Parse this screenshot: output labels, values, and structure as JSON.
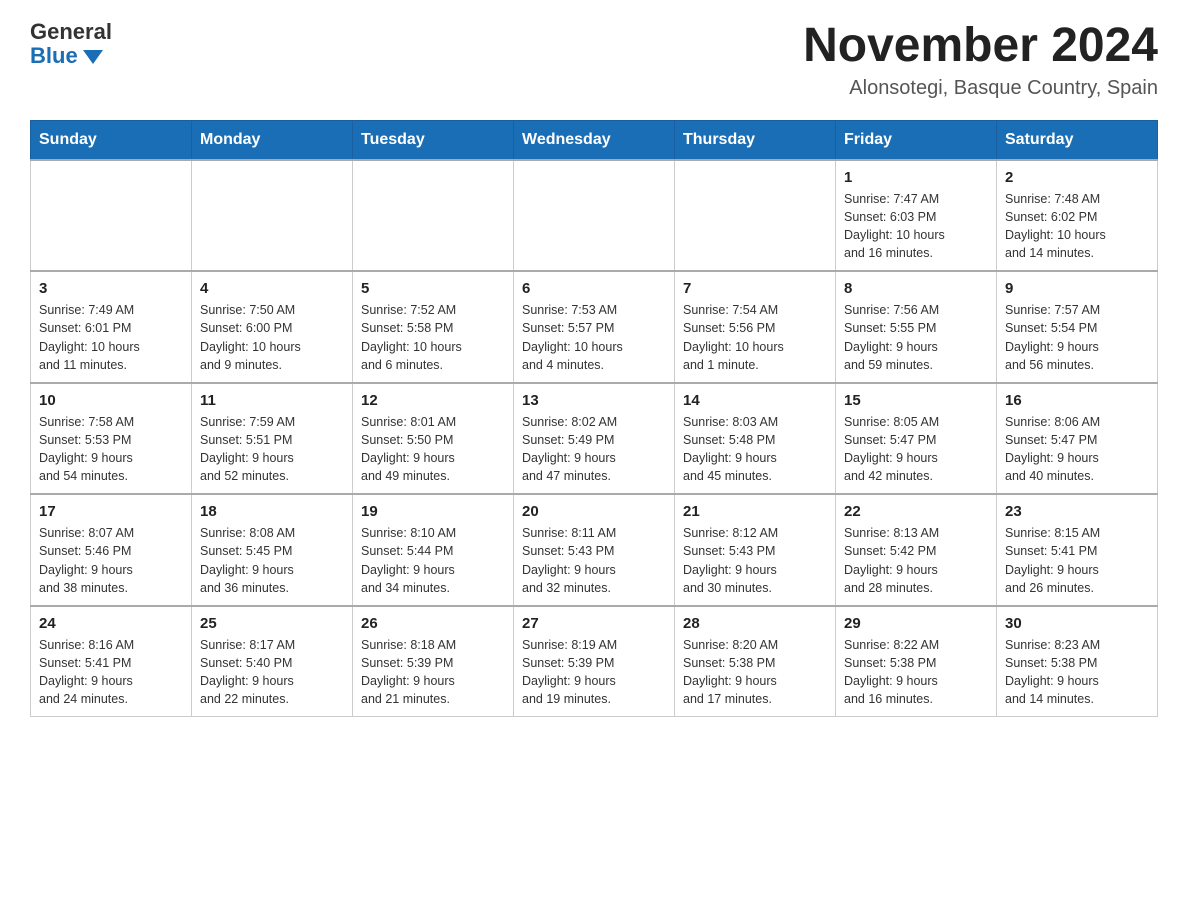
{
  "header": {
    "logo_general": "General",
    "logo_blue": "Blue",
    "title": "November 2024",
    "subtitle": "Alonsotegi, Basque Country, Spain"
  },
  "weekdays": [
    "Sunday",
    "Monday",
    "Tuesday",
    "Wednesday",
    "Thursday",
    "Friday",
    "Saturday"
  ],
  "weeks": [
    [
      {
        "day": "",
        "info": ""
      },
      {
        "day": "",
        "info": ""
      },
      {
        "day": "",
        "info": ""
      },
      {
        "day": "",
        "info": ""
      },
      {
        "day": "",
        "info": ""
      },
      {
        "day": "1",
        "info": "Sunrise: 7:47 AM\nSunset: 6:03 PM\nDaylight: 10 hours\nand 16 minutes."
      },
      {
        "day": "2",
        "info": "Sunrise: 7:48 AM\nSunset: 6:02 PM\nDaylight: 10 hours\nand 14 minutes."
      }
    ],
    [
      {
        "day": "3",
        "info": "Sunrise: 7:49 AM\nSunset: 6:01 PM\nDaylight: 10 hours\nand 11 minutes."
      },
      {
        "day": "4",
        "info": "Sunrise: 7:50 AM\nSunset: 6:00 PM\nDaylight: 10 hours\nand 9 minutes."
      },
      {
        "day": "5",
        "info": "Sunrise: 7:52 AM\nSunset: 5:58 PM\nDaylight: 10 hours\nand 6 minutes."
      },
      {
        "day": "6",
        "info": "Sunrise: 7:53 AM\nSunset: 5:57 PM\nDaylight: 10 hours\nand 4 minutes."
      },
      {
        "day": "7",
        "info": "Sunrise: 7:54 AM\nSunset: 5:56 PM\nDaylight: 10 hours\nand 1 minute."
      },
      {
        "day": "8",
        "info": "Sunrise: 7:56 AM\nSunset: 5:55 PM\nDaylight: 9 hours\nand 59 minutes."
      },
      {
        "day": "9",
        "info": "Sunrise: 7:57 AM\nSunset: 5:54 PM\nDaylight: 9 hours\nand 56 minutes."
      }
    ],
    [
      {
        "day": "10",
        "info": "Sunrise: 7:58 AM\nSunset: 5:53 PM\nDaylight: 9 hours\nand 54 minutes."
      },
      {
        "day": "11",
        "info": "Sunrise: 7:59 AM\nSunset: 5:51 PM\nDaylight: 9 hours\nand 52 minutes."
      },
      {
        "day": "12",
        "info": "Sunrise: 8:01 AM\nSunset: 5:50 PM\nDaylight: 9 hours\nand 49 minutes."
      },
      {
        "day": "13",
        "info": "Sunrise: 8:02 AM\nSunset: 5:49 PM\nDaylight: 9 hours\nand 47 minutes."
      },
      {
        "day": "14",
        "info": "Sunrise: 8:03 AM\nSunset: 5:48 PM\nDaylight: 9 hours\nand 45 minutes."
      },
      {
        "day": "15",
        "info": "Sunrise: 8:05 AM\nSunset: 5:47 PM\nDaylight: 9 hours\nand 42 minutes."
      },
      {
        "day": "16",
        "info": "Sunrise: 8:06 AM\nSunset: 5:47 PM\nDaylight: 9 hours\nand 40 minutes."
      }
    ],
    [
      {
        "day": "17",
        "info": "Sunrise: 8:07 AM\nSunset: 5:46 PM\nDaylight: 9 hours\nand 38 minutes."
      },
      {
        "day": "18",
        "info": "Sunrise: 8:08 AM\nSunset: 5:45 PM\nDaylight: 9 hours\nand 36 minutes."
      },
      {
        "day": "19",
        "info": "Sunrise: 8:10 AM\nSunset: 5:44 PM\nDaylight: 9 hours\nand 34 minutes."
      },
      {
        "day": "20",
        "info": "Sunrise: 8:11 AM\nSunset: 5:43 PM\nDaylight: 9 hours\nand 32 minutes."
      },
      {
        "day": "21",
        "info": "Sunrise: 8:12 AM\nSunset: 5:43 PM\nDaylight: 9 hours\nand 30 minutes."
      },
      {
        "day": "22",
        "info": "Sunrise: 8:13 AM\nSunset: 5:42 PM\nDaylight: 9 hours\nand 28 minutes."
      },
      {
        "day": "23",
        "info": "Sunrise: 8:15 AM\nSunset: 5:41 PM\nDaylight: 9 hours\nand 26 minutes."
      }
    ],
    [
      {
        "day": "24",
        "info": "Sunrise: 8:16 AM\nSunset: 5:41 PM\nDaylight: 9 hours\nand 24 minutes."
      },
      {
        "day": "25",
        "info": "Sunrise: 8:17 AM\nSunset: 5:40 PM\nDaylight: 9 hours\nand 22 minutes."
      },
      {
        "day": "26",
        "info": "Sunrise: 8:18 AM\nSunset: 5:39 PM\nDaylight: 9 hours\nand 21 minutes."
      },
      {
        "day": "27",
        "info": "Sunrise: 8:19 AM\nSunset: 5:39 PM\nDaylight: 9 hours\nand 19 minutes."
      },
      {
        "day": "28",
        "info": "Sunrise: 8:20 AM\nSunset: 5:38 PM\nDaylight: 9 hours\nand 17 minutes."
      },
      {
        "day": "29",
        "info": "Sunrise: 8:22 AM\nSunset: 5:38 PM\nDaylight: 9 hours\nand 16 minutes."
      },
      {
        "day": "30",
        "info": "Sunrise: 8:23 AM\nSunset: 5:38 PM\nDaylight: 9 hours\nand 14 minutes."
      }
    ]
  ]
}
